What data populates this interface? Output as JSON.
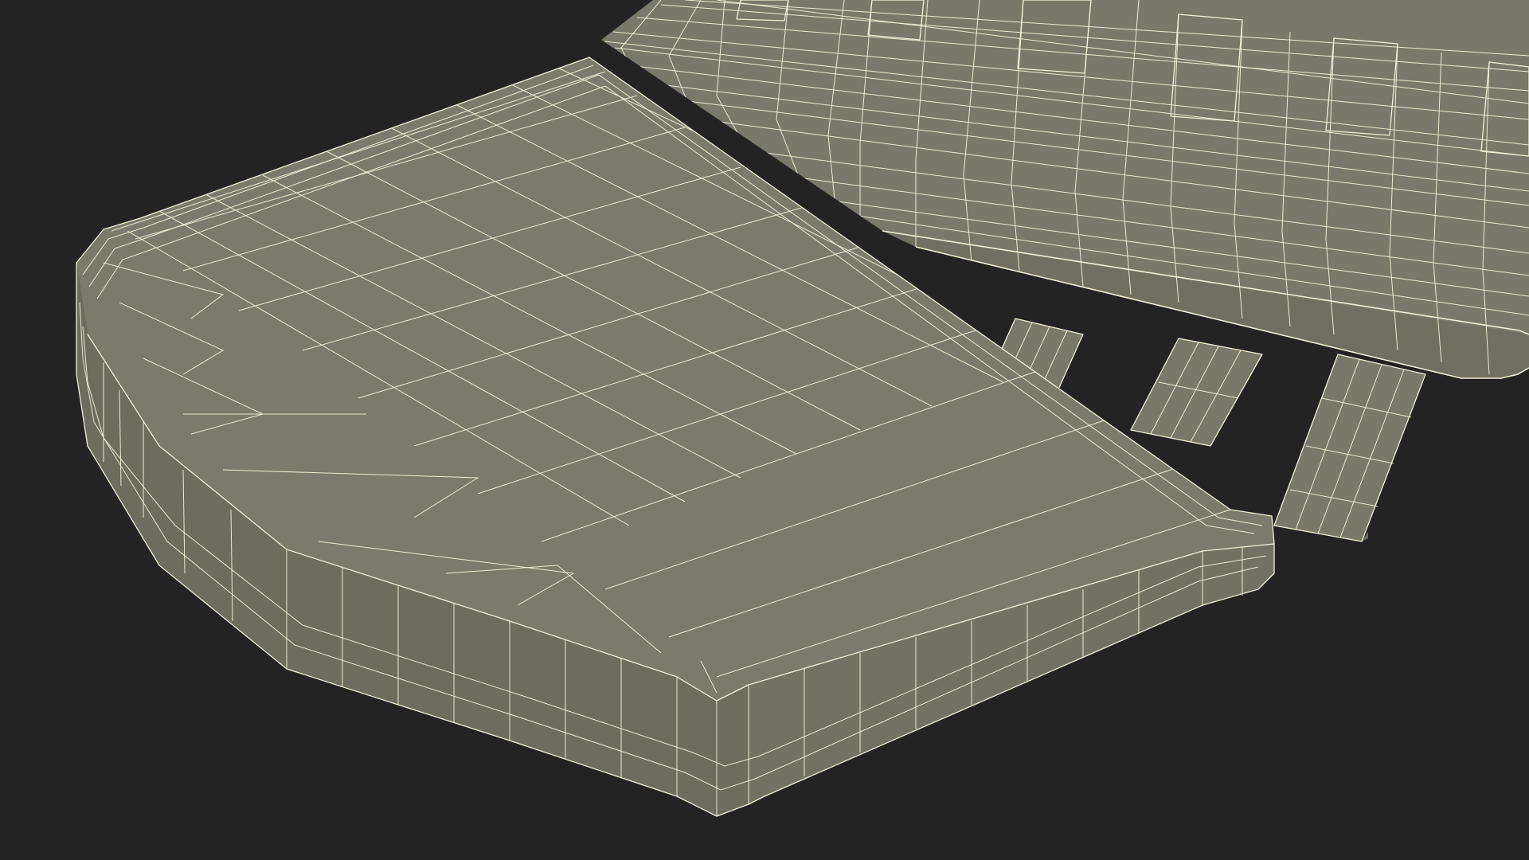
{
  "scene": {
    "background_color": "#232323",
    "surface_color": "#78796a",
    "surface_shade_color": "#6c6d5f",
    "recess_color": "#55564b",
    "wire_color": "#f2f0d8",
    "objects": [
      {
        "name": "seat-cushion",
        "render": "wireframe-shaded"
      },
      {
        "name": "slatted-backrest",
        "render": "wireframe-shaded"
      }
    ]
  }
}
